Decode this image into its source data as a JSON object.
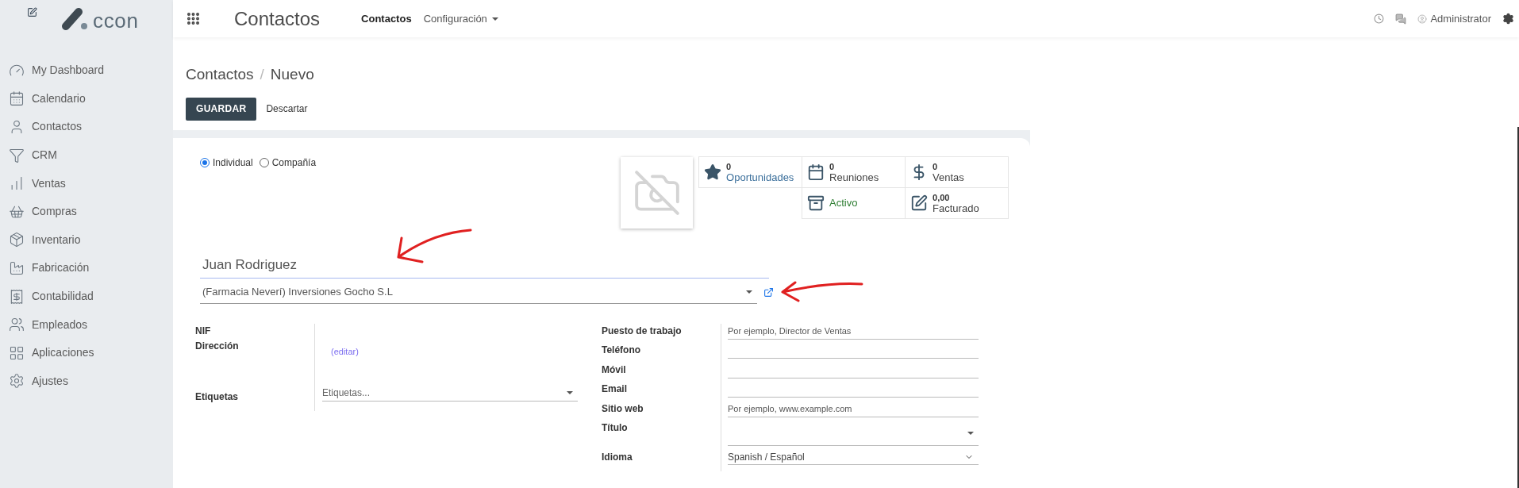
{
  "sidebar": {
    "logo": "ccon",
    "items": [
      {
        "label": "My Dashboard"
      },
      {
        "label": "Calendario"
      },
      {
        "label": "Contactos"
      },
      {
        "label": "CRM"
      },
      {
        "label": "Ventas"
      },
      {
        "label": "Compras"
      },
      {
        "label": "Inventario"
      },
      {
        "label": "Fabricación"
      },
      {
        "label": "Contabilidad"
      },
      {
        "label": "Empleados"
      },
      {
        "label": "Aplicaciones"
      },
      {
        "label": "Ajustes"
      }
    ]
  },
  "topbar": {
    "app_title": "Contactos",
    "menu": [
      {
        "label": "Contactos",
        "selected": true,
        "dropdown": false
      },
      {
        "label": "Configuración",
        "selected": false,
        "dropdown": true
      }
    ],
    "user": "Administrator"
  },
  "breadcrumb": [
    "Contactos",
    "/",
    "Nuevo"
  ],
  "actions": {
    "save": "GUARDAR",
    "discard": "Descartar"
  },
  "form": {
    "type_options": [
      {
        "label": "Individual",
        "selected": true
      },
      {
        "label": "Compañía",
        "selected": false
      }
    ],
    "stat_rows": [
      [
        {
          "kind": "stat",
          "value": "0",
          "label": "Oportunidades"
        },
        {
          "kind": "stat",
          "value": "0",
          "label": "Reuniones"
        },
        {
          "kind": "stat",
          "value": "0",
          "label": "Ventas"
        }
      ],
      [
        {
          "kind": "toggle",
          "label": "Activo"
        },
        {
          "kind": "stat",
          "value": "0,00",
          "label": "Facturado"
        }
      ]
    ],
    "name": "Juan Rodriguez",
    "company": "(Farmacia Neverí) Inversiones Gocho S.L",
    "left_fields": [
      {
        "label": "NIF",
        "kind": "none"
      },
      {
        "label": "Dirección",
        "kind": "link",
        "value": "(editar)"
      },
      {
        "label": "Etiquetas",
        "kind": "select",
        "placeholder": "Etiquetas..."
      }
    ],
    "right_fields": [
      {
        "label": "Puesto de trabajo",
        "kind": "input",
        "placeholder": "Por ejemplo, Director de Ventas"
      },
      {
        "label": "Teléfono",
        "kind": "input"
      },
      {
        "label": "Móvil",
        "kind": "input"
      },
      {
        "label": "Email",
        "kind": "input"
      },
      {
        "label": "Sitio web",
        "kind": "input",
        "placeholder": "Por ejemplo, www.example.com"
      },
      {
        "label": "Título",
        "kind": "select"
      },
      {
        "label": "Idioma",
        "kind": "chevron",
        "value": "Spanish / Español"
      }
    ]
  }
}
